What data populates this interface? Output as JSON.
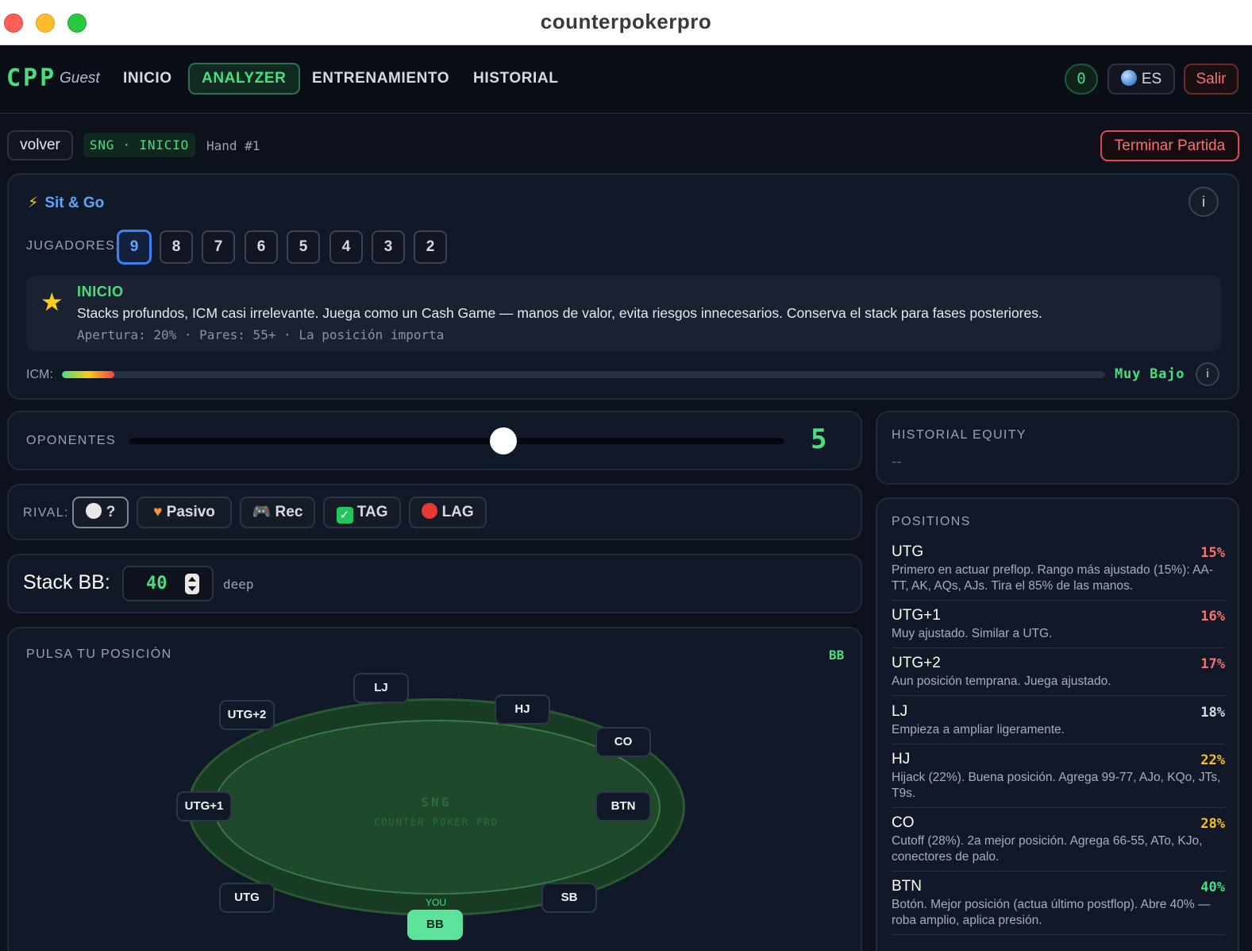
{
  "window": {
    "title": "counterpokerpro"
  },
  "nav": {
    "logo": "CPP",
    "user": "Guest",
    "links": [
      "INICIO",
      "ANALYZER",
      "ENTRENAMIENTO",
      "HISTORIAL"
    ],
    "active": "ANALYZER",
    "count": "0",
    "lang": "ES",
    "logout": "Salir"
  },
  "toolbar": {
    "back": "volver",
    "badge": "SNG · INICIO",
    "hand": "Hand #1",
    "end": "Terminar Partida"
  },
  "sitgo": {
    "title": "Sit & Go",
    "info": "i",
    "players_label": "JUGADORES:",
    "players": [
      "9",
      "8",
      "7",
      "6",
      "5",
      "4",
      "3",
      "2"
    ],
    "players_selected": "9",
    "phase_title": "INICIO",
    "phase_desc": "Stacks profundos, ICM casi irrelevante. Juega como un Cash Game — manos de valor, evita riesgos innecesarios. Conserva el stack para fases posteriores.",
    "phase_meta": "Apertura: 20% · Pares: 55+ · La posición importa",
    "icm_label": "ICM:",
    "icm_value": "Muy Bajo",
    "icm_level": 0.05
  },
  "opponents": {
    "label": "OPONENTES",
    "value": "5",
    "min": 1,
    "max": 8
  },
  "rival": {
    "label": "RIVAL:",
    "options": [
      {
        "icon": "white-circle-icon",
        "label": "?"
      },
      {
        "icon": "orange-heart-icon",
        "label": "Pasivo"
      },
      {
        "icon": "gamepad-icon",
        "label": "Rec"
      },
      {
        "icon": "check-box-icon",
        "label": "TAG"
      },
      {
        "icon": "red-circle-icon",
        "label": "LAG"
      }
    ],
    "selected": "?"
  },
  "stack": {
    "label": "Stack BB:",
    "value": "40",
    "suffix": "deep"
  },
  "table": {
    "label": "PULSA TU POSICIÓN",
    "current": "BB",
    "brand": "SNG",
    "brand_sub": "COUNTER POKER PRO",
    "you_label": "YOU",
    "seats": [
      "LJ",
      "UTG+2",
      "HJ",
      "CO",
      "UTG+1",
      "BTN",
      "UTG",
      "SB",
      "BB"
    ]
  },
  "history": {
    "label": "HISTORIAL EQUITY",
    "value": "--"
  },
  "positions": {
    "label": "POSITIONS",
    "colors": {
      "red": "#f87171",
      "white": "#d6dae2",
      "orange": "#fbbf24",
      "green": "#4ade80"
    },
    "items": [
      {
        "name": "UTG",
        "pct": "15%",
        "tone": "red",
        "desc": "Primero en actuar preflop. Rango más ajustado (15%): AA-TT, AK, AQs, AJs. Tira el 85% de las manos."
      },
      {
        "name": "UTG+1",
        "pct": "16%",
        "tone": "red",
        "desc": "Muy ajustado. Similar a UTG."
      },
      {
        "name": "UTG+2",
        "pct": "17%",
        "tone": "red",
        "desc": "Aun posición temprana. Juega ajustado."
      },
      {
        "name": "LJ",
        "pct": "18%",
        "tone": "white",
        "desc": "Empieza a ampliar ligeramente."
      },
      {
        "name": "HJ",
        "pct": "22%",
        "tone": "orange",
        "desc": "Hijack (22%). Buena posición. Agrega 99-77, AJo, KQo, JTs, T9s."
      },
      {
        "name": "CO",
        "pct": "28%",
        "tone": "orange",
        "desc": "Cutoff (28%). 2a mejor posición. Agrega 66-55, ATo, KJo, conectores de palo."
      },
      {
        "name": "BTN",
        "pct": "40%",
        "tone": "green",
        "desc": "Botón. Mejor posición (actua último postflop). Abre 40% — roba amplio, aplica presión."
      }
    ]
  }
}
